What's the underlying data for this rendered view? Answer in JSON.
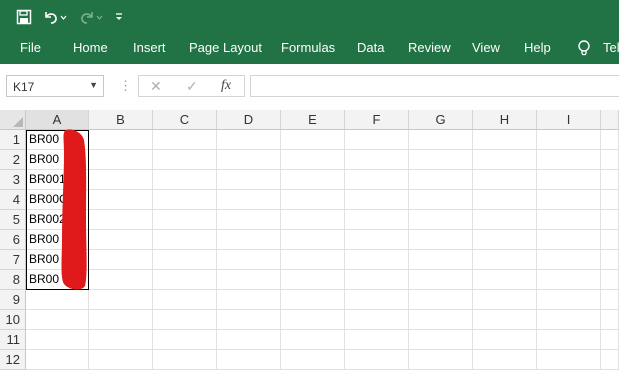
{
  "ribbon": {
    "color": "#217346",
    "quick_access": [
      {
        "name": "save-icon"
      },
      {
        "name": "undo-icon"
      },
      {
        "name": "redo-icon"
      },
      {
        "name": "customize-icon"
      }
    ],
    "tabs": [
      "File",
      "Home",
      "Insert",
      "Page Layout",
      "Formulas",
      "Data",
      "Review",
      "View",
      "Help",
      "Tel"
    ]
  },
  "formula_bar": {
    "name_box": "K17",
    "fx": "fx",
    "cancel": "✕",
    "enter": "✓",
    "value": ""
  },
  "sheet": {
    "columns": [
      "A",
      "B",
      "C",
      "D",
      "E",
      "F",
      "G",
      "H",
      "I"
    ],
    "rows": [
      "1",
      "2",
      "3",
      "4",
      "5",
      "6",
      "7",
      "8",
      "9",
      "10",
      "11",
      "12"
    ],
    "column_a_values": [
      "BR00",
      "BR00",
      "BR001",
      "BR00C",
      "BR002",
      "BR00",
      "BR00",
      "BR00"
    ],
    "redaction_color": "#e0191b"
  }
}
